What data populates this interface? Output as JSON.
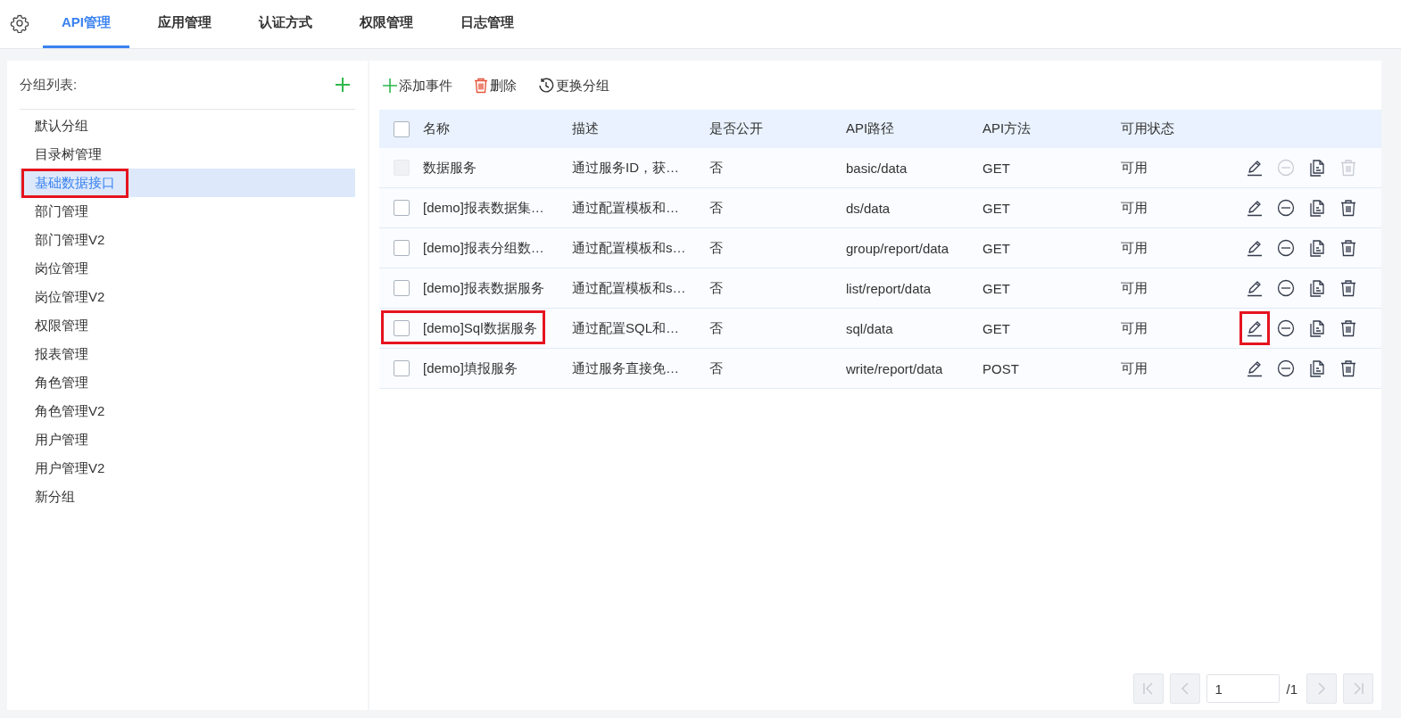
{
  "tabs": [
    {
      "label": "API管理",
      "selected": true
    },
    {
      "label": "应用管理",
      "selected": false
    },
    {
      "label": "认证方式",
      "selected": false
    },
    {
      "label": "权限管理",
      "selected": false
    },
    {
      "label": "日志管理",
      "selected": false
    }
  ],
  "sidebar": {
    "title": "分组列表:",
    "items": [
      {
        "label": "默认分组",
        "selected": false,
        "highlighted": false
      },
      {
        "label": "目录树管理",
        "selected": false,
        "highlighted": false
      },
      {
        "label": "基础数据接口",
        "selected": true,
        "highlighted": true
      },
      {
        "label": "部门管理",
        "selected": false,
        "highlighted": false
      },
      {
        "label": "部门管理V2",
        "selected": false,
        "highlighted": false
      },
      {
        "label": "岗位管理",
        "selected": false,
        "highlighted": false
      },
      {
        "label": "岗位管理V2",
        "selected": false,
        "highlighted": false
      },
      {
        "label": "权限管理",
        "selected": false,
        "highlighted": false
      },
      {
        "label": "报表管理",
        "selected": false,
        "highlighted": false
      },
      {
        "label": "角色管理",
        "selected": false,
        "highlighted": false
      },
      {
        "label": "角色管理V2",
        "selected": false,
        "highlighted": false
      },
      {
        "label": "用户管理",
        "selected": false,
        "highlighted": false
      },
      {
        "label": "用户管理V2",
        "selected": false,
        "highlighted": false
      },
      {
        "label": "新分组",
        "selected": false,
        "highlighted": false
      }
    ]
  },
  "toolbar": [
    {
      "kind": "add",
      "label": "添加事件"
    },
    {
      "kind": "delete",
      "label": "删除"
    },
    {
      "kind": "regroup",
      "label": "更换分组"
    }
  ],
  "table": {
    "all_checked": false,
    "columns": [
      "名称",
      "描述",
      "是否公开",
      "API路径",
      "API方法",
      "可用状态"
    ],
    "rows": [
      {
        "disabled": true,
        "checked": false,
        "name_highlighted": false,
        "edit_highlighted": false,
        "cells": [
          "数据服务",
          "通过服务ID，获…",
          "否",
          "basic/data",
          "GET",
          "可用"
        ]
      },
      {
        "disabled": false,
        "checked": false,
        "name_highlighted": false,
        "edit_highlighted": false,
        "cells": [
          "[demo]报表数据集…",
          "通过配置模板和…",
          "否",
          "ds/data",
          "GET",
          "可用"
        ]
      },
      {
        "disabled": false,
        "checked": false,
        "name_highlighted": false,
        "edit_highlighted": false,
        "cells": [
          "[demo]报表分组数…",
          "通过配置模板和s…",
          "否",
          "group/report/data",
          "GET",
          "可用"
        ]
      },
      {
        "disabled": false,
        "checked": false,
        "name_highlighted": false,
        "edit_highlighted": false,
        "cells": [
          "[demo]报表数据服务",
          "通过配置模板和s…",
          "否",
          "list/report/data",
          "GET",
          "可用"
        ]
      },
      {
        "disabled": false,
        "checked": false,
        "name_highlighted": true,
        "edit_highlighted": true,
        "cells": [
          "[demo]Sql数据服务",
          "通过配置SQL和…",
          "否",
          "sql/data",
          "GET",
          "可用"
        ]
      },
      {
        "disabled": false,
        "checked": false,
        "name_highlighted": false,
        "edit_highlighted": false,
        "cells": [
          "[demo]填报服务",
          "通过服务直接免…",
          "否",
          "write/report/data",
          "POST",
          "可用"
        ]
      }
    ]
  },
  "pagination": {
    "page": "1",
    "total": "/1"
  }
}
